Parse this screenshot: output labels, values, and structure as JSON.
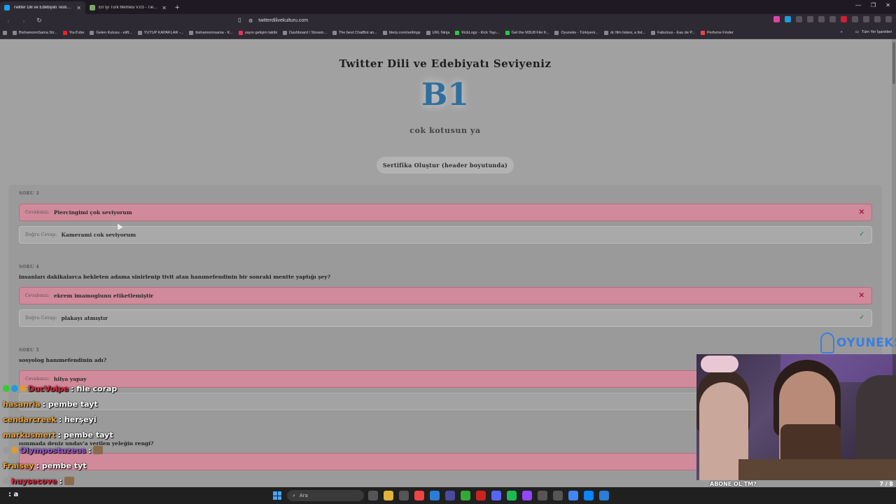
{
  "browser": {
    "tabs": [
      {
        "title": "Twitter Dili ve Edebiyatı Testini Y...",
        "active": true
      },
      {
        "title": "En İyi Türk Memesi V.03 - Tier List, Kı...",
        "active": false
      }
    ],
    "new_tab": "+",
    "url": "twitterdilivekulturu.com",
    "bookmarks": [
      "BishamonnSama Str...",
      "YouTube",
      "Gelen Kutusu - elift...",
      "YUTUP KAPAKLAR -...",
      "bishamonnsama - K...",
      "yayın gelişim takibi",
      "Dashboard / Stream...",
      "The best ChatBot an...",
      "blerp.com/settings",
      "URL Ninja",
      "KickLogz - Kick Yayı...",
      "Get the M3U8 File fr...",
      "Oyuneks - Türkiyeni...",
      "dc film listesi, a list...",
      "Fabulous - Eau de P...",
      "Perfume Finder"
    ],
    "bookmarks_more": "»",
    "all_bookmarks": "Tüm Yer İşaretleri"
  },
  "page": {
    "title": "Twitter Dili ve Edebiyatı Seviyeniz",
    "level": "B1",
    "level_comment": "cok kotusun ya",
    "certificate_button": "Sertifika Oluştur (header boyutunda)",
    "answer_label": "Cevabınız:",
    "correct_label": "Doğru Cevap:",
    "questions": [
      {
        "label": "SORU 3",
        "text": "",
        "your_answer": "Piercingimi çok seviyorum",
        "correct_answer": "Kamerami cok seviyorum"
      },
      {
        "label": "SORU 4",
        "text": "insanları dakikalarca bekleten adama sinirlenip tivit atan hanımefendinin bir sonraki mentte yaptığı şey?",
        "your_answer": "ekrem imamoglunu etiketlemiştir",
        "correct_answer": "plakayı atmıştır"
      },
      {
        "label": "SORU 5",
        "text": "sosyolog hanımefendinin adı?",
        "your_answer": "hilya yapay",
        "correct_answer": ""
      },
      {
        "label": "",
        "text": "ısınmada deniz undav'a verilen yeleğin rengi?",
        "your_answer": "",
        "correct_answer": ""
      }
    ]
  },
  "chat": [
    {
      "user": "DucVolpe",
      "text": "file corap",
      "color": "#d7263d"
    },
    {
      "user": "hasanria",
      "text": "pembe tayt",
      "color": "#e8a33d"
    },
    {
      "user": "cendarcreek",
      "text": "herşeyi",
      "color": "#e8a33d"
    },
    {
      "user": "markusmert",
      "text": "pembe tayt",
      "color": "#e8a33d"
    },
    {
      "user": "Olympostuzeus",
      "text": "",
      "color": "#9b59d0"
    },
    {
      "user": "Fraisey",
      "text": "pembe tyt",
      "color": "#e8a33d"
    },
    {
      "user": "huysecove",
      "text": "",
      "color": "#d7263d"
    },
    {
      "user": "",
      "text": "a",
      "color": "#d7263d"
    }
  ],
  "overlay": {
    "brand": "OYUNEKS",
    "subscribe_text": "ABONE OL TM?",
    "subscribe_count": "7 / 8",
    "subscribe_progress": 0.875
  },
  "taskbar": {
    "search_placeholder": "Ara"
  },
  "colors": {
    "accent": "#2f6f9e",
    "wrong": "#d08a9a",
    "wrong_mark": "#a01b3a",
    "right_mark": "#4f7f5d"
  }
}
